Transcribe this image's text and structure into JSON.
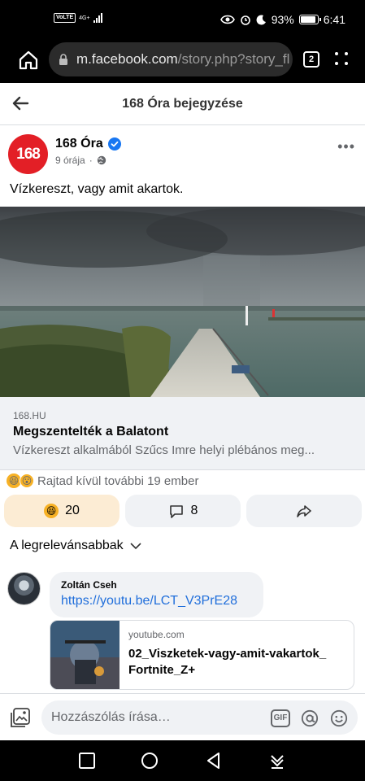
{
  "status_bar": {
    "volte": "VoLTE",
    "network": "4G+",
    "battery_pct": "93%",
    "battery_level": 0.93,
    "time": "6:41"
  },
  "browser": {
    "url_host": "m.facebook.com",
    "url_path": "/story.php?story_fl",
    "tab_count": "2"
  },
  "header": {
    "title": "168 Óra bejegyzése"
  },
  "post": {
    "page_avatar_text": "168",
    "page_name": "168 Óra",
    "time_ago": "9 órája",
    "dot": "·",
    "text": "Vízkereszt, vagy amit akartok.",
    "link": {
      "domain": "168.HU",
      "title": "Megszentelték a Balatont",
      "description": "Vízkereszt alkalmából Szűcs Imre helyi plébános meg..."
    },
    "reactions_summary": "Rajtad kívül további 19 ember",
    "reaction_emojis": [
      "😆",
      "😮"
    ]
  },
  "actions": {
    "reaction_count": "20",
    "reaction_emoji": "😆",
    "comment_count": "8"
  },
  "comments": {
    "sort_label": "A legrelevánsabbak",
    "items": [
      {
        "author": "Zoltán Cseh",
        "link_text": "https://youtu.be/LCT_V3PrE28",
        "preview": {
          "domain": "youtube.com",
          "title": "02_Viszketek-vagy-amit-vakartok_ Fortnite_Z+"
        }
      }
    ]
  },
  "composer": {
    "placeholder": "Hozzászólás írása…",
    "gif_label": "GIF"
  },
  "colors": {
    "accent_blue": "#1877f2",
    "link_blue": "#216fdb",
    "brand_red": "#e31f26",
    "bubble_gray": "#f0f2f5"
  }
}
